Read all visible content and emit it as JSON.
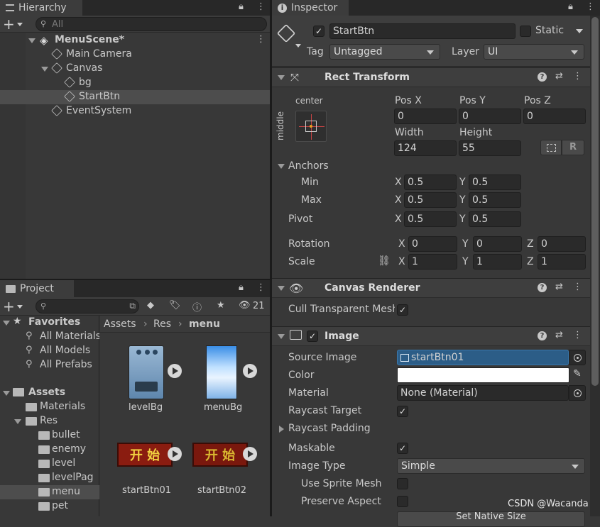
{
  "hierarchy": {
    "tab_label": "Hierarchy",
    "search_placeholder": "All",
    "items": [
      {
        "label": "MenuScene*"
      },
      {
        "label": "Main Camera"
      },
      {
        "label": "Canvas"
      },
      {
        "label": "bg"
      },
      {
        "label": "StartBtn"
      },
      {
        "label": "EventSystem"
      }
    ]
  },
  "project": {
    "tab_label": "Project",
    "hidden_count": "21",
    "favorites_label": "Favorites",
    "favorites": [
      "All Materials",
      "All Models",
      "All Prefabs"
    ],
    "assets_label": "Assets",
    "folders": [
      "Materials",
      "Res",
      "bullet",
      "enemy",
      "level",
      "levelPag",
      "menu",
      "pet"
    ],
    "breadcrumb": [
      "Assets",
      "Res",
      "menu"
    ],
    "grid": [
      {
        "label": "levelBg"
      },
      {
        "label": "menuBg"
      },
      {
        "label": "startBtn01",
        "glyphs": "开 始"
      },
      {
        "label": "startBtn02",
        "glyphs": "开 始"
      }
    ]
  },
  "inspector": {
    "tab_label": "Inspector",
    "object_name": "StartBtn",
    "static_label": "Static",
    "tag_label": "Tag",
    "tag_value": "Untagged",
    "layer_label": "Layer",
    "layer_value": "UI",
    "rect_transform": {
      "title": "Rect Transform",
      "anchor_h": "center",
      "anchor_v": "middle",
      "pos_x_label": "Pos X",
      "pos_x": "0",
      "pos_y_label": "Pos Y",
      "pos_y": "0",
      "pos_z_label": "Pos Z",
      "pos_z": "0",
      "width_label": "Width",
      "width": "124",
      "height_label": "Height",
      "height": "55",
      "r_button": "R",
      "anchors_label": "Anchors",
      "min_label": "Min",
      "min_x": "0.5",
      "min_y": "0.5",
      "max_label": "Max",
      "max_x": "0.5",
      "max_y": "0.5",
      "pivot_label": "Pivot",
      "pivot_x": "0.5",
      "pivot_y": "0.5",
      "rotation_label": "Rotation",
      "rot_x": "0",
      "rot_y": "0",
      "rot_z": "0",
      "scale_label": "Scale",
      "scale_x": "1",
      "scale_y": "1",
      "scale_z": "1",
      "x": "X",
      "y": "Y",
      "z": "Z"
    },
    "canvas_renderer": {
      "title": "Canvas Renderer",
      "cull_label": "Cull Transparent Mesh"
    },
    "image": {
      "title": "Image",
      "source_image_label": "Source Image",
      "source_image": "startBtn01",
      "color_label": "Color",
      "material_label": "Material",
      "material": "None (Material)",
      "raycast_target_label": "Raycast Target",
      "raycast_padding_label": "Raycast Padding",
      "maskable_label": "Maskable",
      "image_type_label": "Image Type",
      "image_type": "Simple",
      "use_sprite_mesh_label": "Use Sprite Mesh",
      "preserve_aspect_label": "Preserve Aspect",
      "set_native_size": "Set Native Size"
    }
  },
  "watermark": "CSDN @Wacanda",
  "colors": {
    "selection": "#2c5d87",
    "panel": "#383838",
    "header": "#282828"
  }
}
